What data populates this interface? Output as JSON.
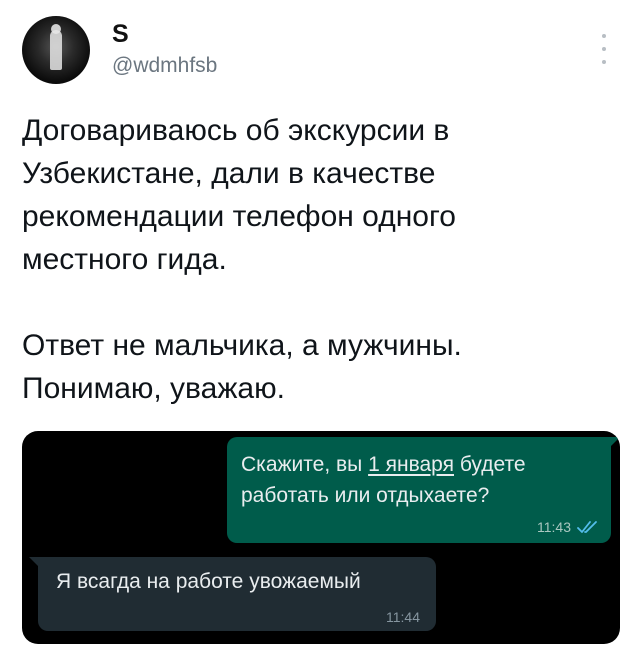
{
  "author": {
    "display_name": "S",
    "handle": "@wdmhfsb",
    "avatar_icon": "avatar-silhouette"
  },
  "tweet": {
    "paragraph_1": "Договариваюсь об экскурсии в\nУзбекистане, дали в качестве\nрекомендации телефон одного\nместного гида.",
    "paragraph_2": "Ответ не мальчика, а мужчины.\nПонимаю, уважаю."
  },
  "chat": {
    "outgoing": {
      "text_before": "Скажите, вы ",
      "date_link": "1 января",
      "text_after": " будете работать или отдыхаете?",
      "time": "11:43",
      "status_icon": "double-check-icon"
    },
    "incoming": {
      "text": "Я всагда на работе увожаемый",
      "time": "11:44"
    }
  },
  "colors": {
    "outgoing_bubble": "#005c4b",
    "incoming_bubble": "#202c33",
    "read_ticks": "#53bdeb",
    "handle_gray": "#6b7680"
  }
}
